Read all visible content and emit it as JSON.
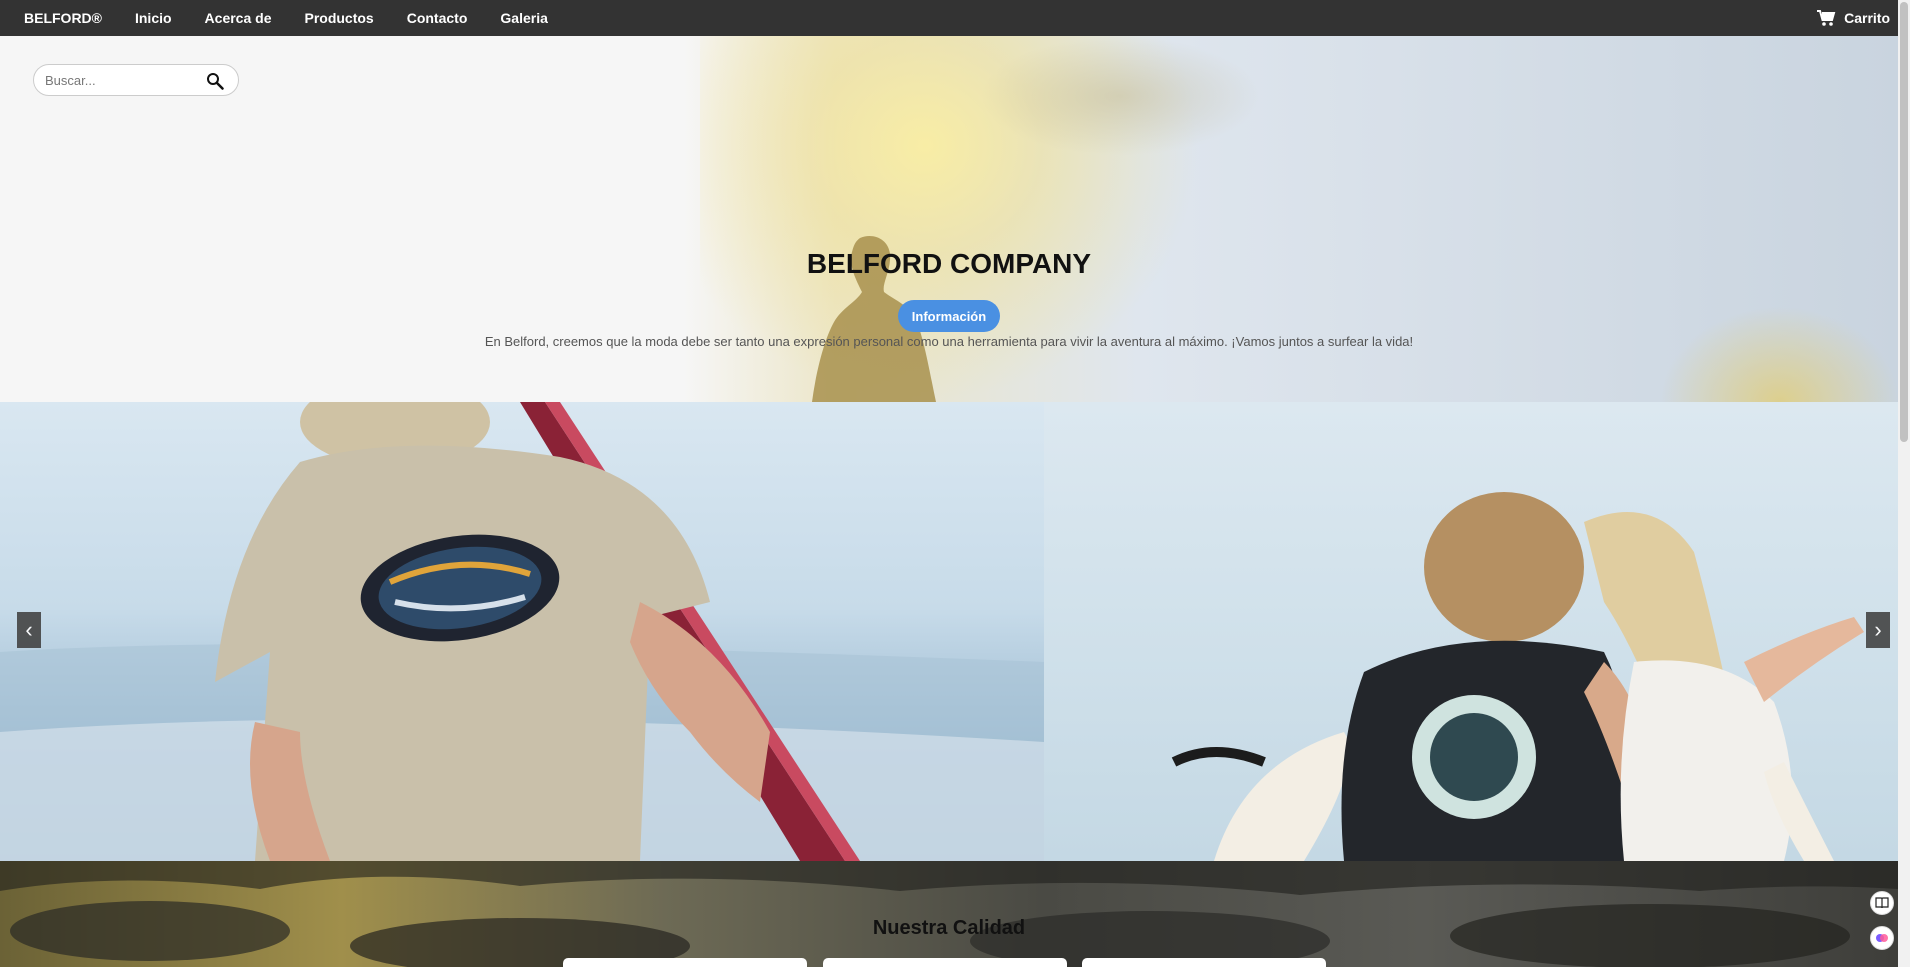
{
  "nav": {
    "brand": "BELFORD®",
    "links": [
      "Inicio",
      "Acerca de",
      "Productos",
      "Contacto",
      "Galeria"
    ],
    "cart_label": "Carrito"
  },
  "search": {
    "placeholder": "Buscar..."
  },
  "hero": {
    "title": "BELFORD COMPANY",
    "button_label": "Información",
    "description": "En Belford, creemos que la moda debe ser tanto una expresión personal como una herramienta para vivir la aventura al máximo. ¡Vamos juntos a surfear la vida!"
  },
  "carousel": {
    "prev_icon": "‹",
    "next_icon": "›"
  },
  "quality": {
    "title": "Nuestra Calidad"
  },
  "colors": {
    "navbar": "#333333",
    "accent": "#4a90e2"
  }
}
